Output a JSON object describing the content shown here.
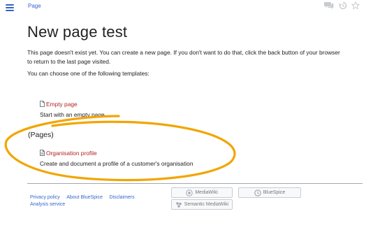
{
  "header": {
    "breadcrumb": "Page",
    "icons": [
      "menu-icon",
      "discussion-icon",
      "history-icon",
      "watch-star-icon"
    ]
  },
  "content": {
    "title": "New page test",
    "intro_line1": "This page doesn't exist yet. You can create a new page. If you don't want to do that, click the back button of your browser",
    "intro_line2": "to return to the last page visited.",
    "choose_text": "You can choose one of the following templates:",
    "templates": [
      {
        "label": "Empty page",
        "description": "Start with an empty page."
      }
    ],
    "section_heading": "(Pages)",
    "section_templates": [
      {
        "label": "Organisation profile",
        "description": "Create and document a profile of a customer's organisation"
      }
    ],
    "highlight_color": "#f2a500",
    "link_color": "#b32424"
  },
  "footer": {
    "links": [
      "Privacy policy",
      "About BlueSpice",
      "Disclaimers"
    ],
    "analysis_link": "Analysis service",
    "badges": [
      "MediaWiki",
      "BlueSpice",
      "Semantic MediaWiki"
    ]
  }
}
